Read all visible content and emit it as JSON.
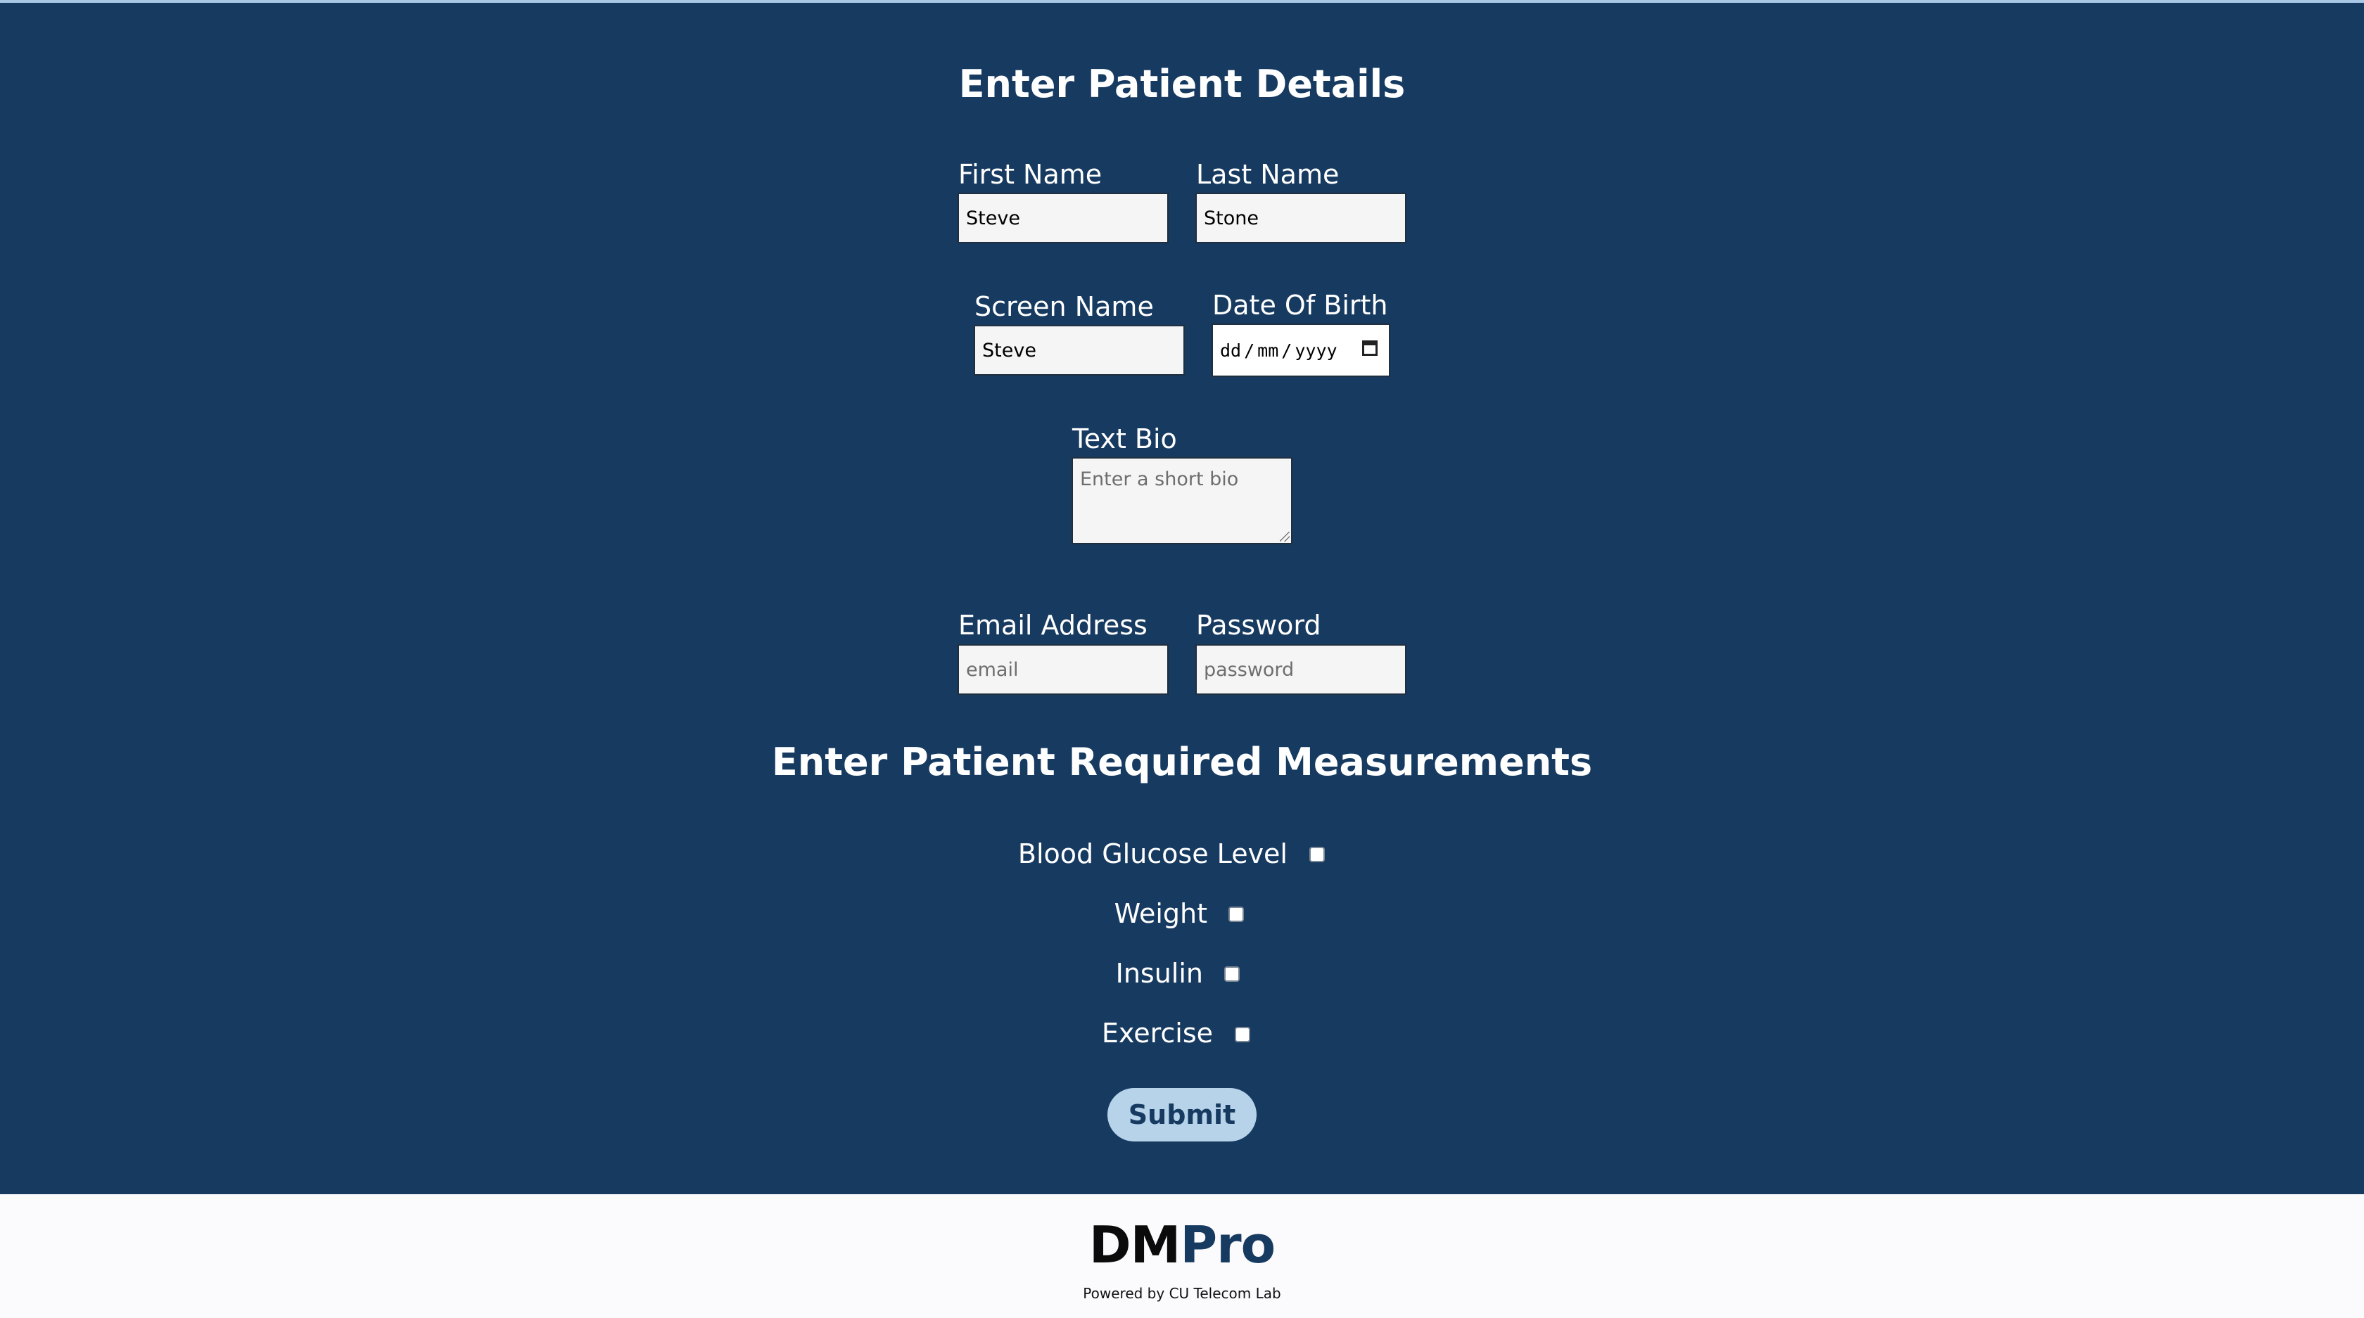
{
  "details": {
    "heading": "Enter Patient Details",
    "first_name": {
      "label": "First Name",
      "value": "Steve"
    },
    "last_name": {
      "label": "Last Name",
      "value": "Stone"
    },
    "screen_name": {
      "label": "Screen Name",
      "value": "Steve"
    },
    "date_of_birth": {
      "label": "Date Of Birth",
      "day": "dd",
      "month": "mm",
      "year": "yyyy",
      "separator": "/",
      "icon": "calendar-icon"
    },
    "text_bio": {
      "label": "Text Bio",
      "placeholder": "Enter a short bio"
    },
    "email": {
      "label": "Email Address",
      "placeholder": "email"
    },
    "password": {
      "label": "Password",
      "placeholder": "password"
    }
  },
  "measurements": {
    "heading": "Enter Patient Required Measurements",
    "items": [
      {
        "label": "Blood Glucose Level",
        "checked": false
      },
      {
        "label": "Weight",
        "checked": false
      },
      {
        "label": "Insulin",
        "checked": false
      },
      {
        "label": "Exercise",
        "checked": false
      }
    ]
  },
  "submit_label": "Submit",
  "footer": {
    "logo_part1": "DM",
    "logo_part2": "Pro",
    "tagline": "Powered by CU Telecom Lab"
  },
  "colors": {
    "background": "#173a61",
    "footer_background": "#fbfafc",
    "button": "#b6d3ea",
    "accent_border": "#a9c8e6"
  }
}
